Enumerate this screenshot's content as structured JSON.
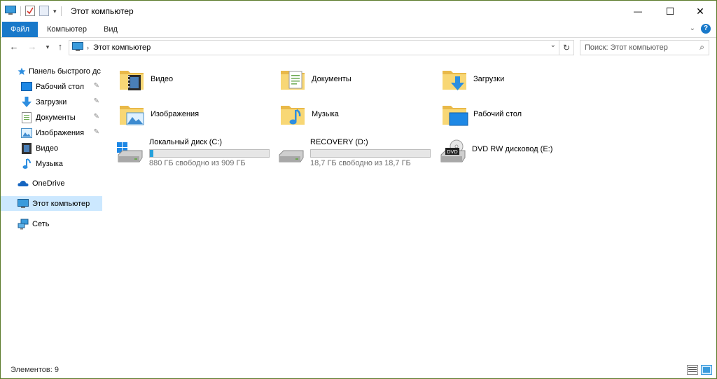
{
  "window": {
    "title": "Этот компьютер",
    "controls": {
      "minimize": "—",
      "maximize": "☐",
      "close": "✕"
    }
  },
  "ribbon": {
    "tabs": [
      {
        "label": "Файл",
        "active": true
      },
      {
        "label": "Компьютер"
      },
      {
        "label": "Вид"
      }
    ],
    "help": "?"
  },
  "address": {
    "crumb": "Этот компьютер",
    "search_placeholder": "Поиск: Этот компьютер"
  },
  "sidebar": {
    "items": [
      {
        "label": "Панель быстрого дс",
        "icon": "star-icon"
      },
      {
        "label": "Рабочий стол",
        "icon": "desktop-icon",
        "pinned": true
      },
      {
        "label": "Загрузки",
        "icon": "download-icon",
        "pinned": true
      },
      {
        "label": "Документы",
        "icon": "documents-icon",
        "pinned": true
      },
      {
        "label": "Изображения",
        "icon": "pictures-icon",
        "pinned": true
      },
      {
        "label": "Видео",
        "icon": "video-icon"
      },
      {
        "label": "Музыка",
        "icon": "music-icon"
      },
      {
        "label": "OneDrive",
        "icon": "cloud-icon"
      },
      {
        "label": "Этот компьютер",
        "icon": "computer-icon",
        "selected": true
      },
      {
        "label": "Сеть",
        "icon": "network-icon"
      }
    ]
  },
  "folders": [
    {
      "label": "Видео",
      "icon": "video-folder-icon"
    },
    {
      "label": "Документы",
      "icon": "documents-folder-icon"
    },
    {
      "label": "Загрузки",
      "icon": "downloads-folder-icon"
    },
    {
      "label": "Изображения",
      "icon": "pictures-folder-icon"
    },
    {
      "label": "Музыка",
      "icon": "music-folder-icon"
    },
    {
      "label": "Рабочий стол",
      "icon": "desktop-folder-icon"
    }
  ],
  "drives": [
    {
      "name": "Локальный диск (C:)",
      "free": "880 ГБ свободно из 909 ГБ",
      "used_fraction": 0.032,
      "icon": "windows-drive-icon"
    },
    {
      "name": "RECOVERY (D:)",
      "free": "18,7 ГБ свободно из 18,7 ГБ",
      "used_fraction": 0.0,
      "icon": "drive-icon"
    },
    {
      "name": "DVD RW дисковод (E:)",
      "icon": "dvd-drive-icon"
    }
  ],
  "status": {
    "count": "Элементов: 9"
  },
  "colors": {
    "accent": "#1979ca",
    "selection": "#cce8ff",
    "folder": "#f8d775",
    "bar_fill": "#26a0da"
  }
}
